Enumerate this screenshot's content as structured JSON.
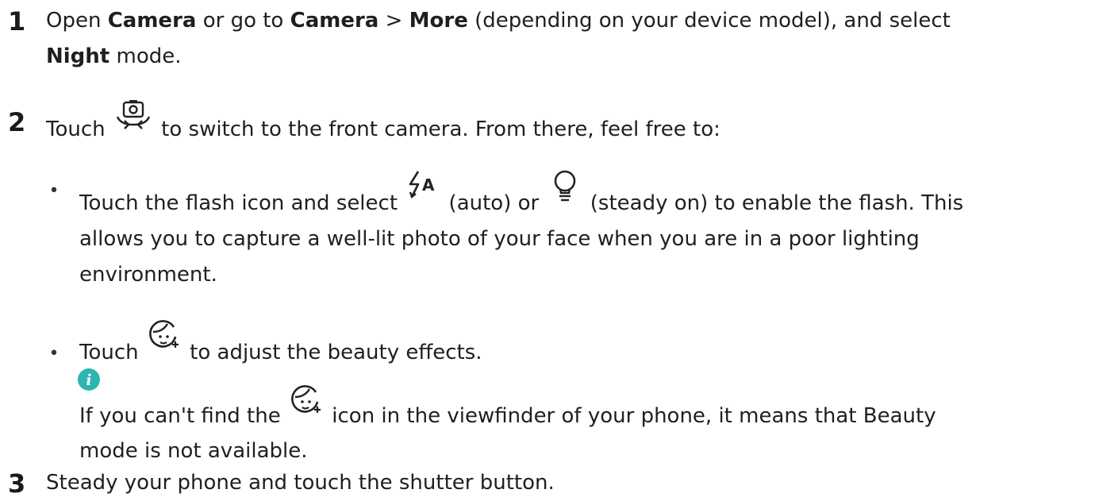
{
  "step1": {
    "number": "1",
    "t1": "Open ",
    "b1": "Camera",
    "t2": " or go to ",
    "b2": "Camera",
    "t3": " > ",
    "b3": "More",
    "t4": " (depending on your device model), and select",
    "b4": "Night",
    "t5": " mode."
  },
  "step2": {
    "number": "2",
    "t1": "Touch ",
    "t2": " to switch to the front camera. From there, feel free to:",
    "bullet1": {
      "t1": "Touch the flash icon and select ",
      "t2": " (auto) or ",
      "t3": " (steady on) to enable the flash. This",
      "line2": "allows you to capture a well-lit photo of your face when you are in a poor lighting",
      "line3": "environment."
    },
    "bullet2": {
      "t1": "Touch ",
      "t2": " to adjust the beauty effects."
    },
    "note": {
      "t1": "If you can't find the ",
      "t2": " icon in the viewfinder of your phone, it means that Beauty",
      "line2": "mode is not available."
    }
  },
  "step3": {
    "number": "3",
    "text": "Steady your phone and touch the shutter button."
  },
  "icons": {
    "camera_switch": "switch-camera-icon",
    "flash_auto": "flash-auto-icon",
    "flash_steady": "bulb-icon",
    "beauty": "beauty-face-icon",
    "info": "info-icon",
    "info_color": "#2bb6b0"
  }
}
